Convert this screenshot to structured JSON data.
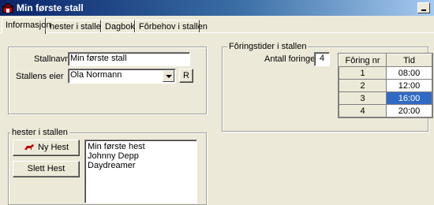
{
  "window": {
    "title": "Min første stall"
  },
  "tabs": [
    {
      "label": "Informasjon",
      "active": true
    },
    {
      "label": "hester i stallen",
      "active": false
    },
    {
      "label": "Dagbok",
      "active": false
    },
    {
      "label": "Fôrbehov i stallen",
      "active": false
    }
  ],
  "stable": {
    "name_label": "Stallnavn",
    "name_value": "Min første stall",
    "owner_label": "Stallens eier",
    "owner_value": "Ola Normann",
    "r_button": "R"
  },
  "feeding": {
    "group_label": "Fôringstider i stallen",
    "count_label": "Antall foringer",
    "count_value": "4",
    "headers": [
      "Fôring nr",
      "Tid"
    ],
    "rows": [
      {
        "nr": "1",
        "time": "08:00"
      },
      {
        "nr": "2",
        "time": "12:00"
      },
      {
        "nr": "3",
        "time": "16:00"
      },
      {
        "nr": "4",
        "time": "20:00"
      }
    ],
    "selected_row": 2
  },
  "horses": {
    "group_label": "hester i stallen",
    "new_button": "Ny Hest",
    "delete_button": "Slett Hest",
    "list": [
      "Min første hest",
      "Johnny Depp",
      "Daydreamer"
    ]
  },
  "colors": {
    "title_start": "#0a246a",
    "title_end": "#a6caf0",
    "selection": "#316ac5",
    "face": "#ece9d8"
  }
}
